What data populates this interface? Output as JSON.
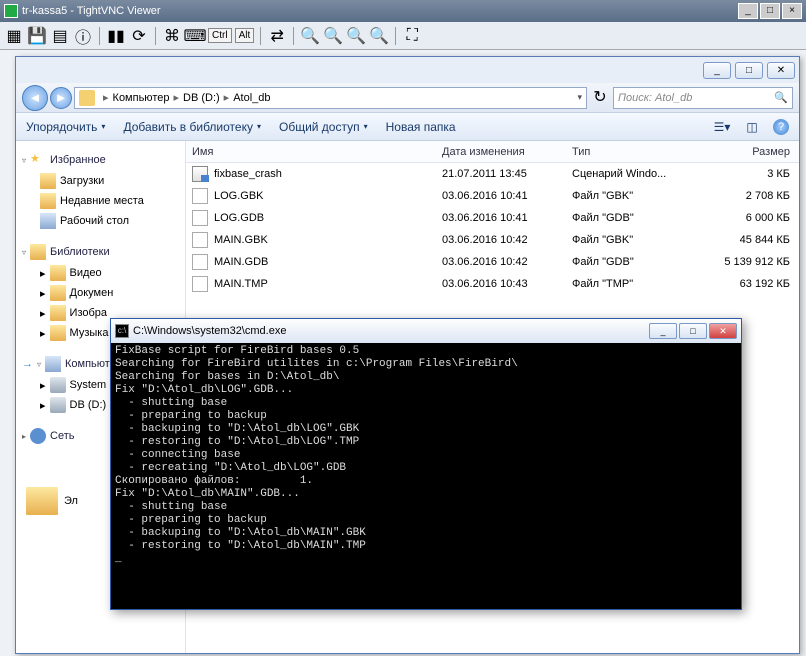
{
  "vnc": {
    "title": "tr-kassa5 - TightVNC Viewer",
    "ctrl": "Ctrl",
    "alt": "Alt"
  },
  "explorer": {
    "breadcrumb": [
      "Компьютер",
      "DB (D:)",
      "Atol_db"
    ],
    "search_placeholder": "Поиск: Atol_db",
    "menu": {
      "organize": "Упорядочить",
      "library": "Добавить в библиотеку",
      "share": "Общий доступ",
      "newfolder": "Новая папка"
    },
    "columns": {
      "name": "Имя",
      "date": "Дата изменения",
      "type": "Тип",
      "size": "Размер"
    },
    "sidebar": {
      "favorites": "Избранное",
      "fav_items": [
        "Загрузки",
        "Недавние места",
        "Рабочий стол"
      ],
      "libraries": "Библиотеки",
      "lib_items": [
        "Видео",
        "Докумен",
        "Изобра",
        "Музыка"
      ],
      "computer": "Компьют",
      "comp_items": [
        "System (",
        "DB (D:)"
      ],
      "network": "Сеть",
      "elements_prefix": "Эл"
    },
    "files": [
      {
        "name": "fixbase_crash",
        "date": "21.07.2011 13:45",
        "type": "Сценарий Windo...",
        "size": "3 КБ",
        "icon": "script"
      },
      {
        "name": "LOG.GBK",
        "date": "03.06.2016 10:41",
        "type": "Файл \"GBK\"",
        "size": "2 708 КБ",
        "icon": "file"
      },
      {
        "name": "LOG.GDB",
        "date": "03.06.2016 10:41",
        "type": "Файл \"GDB\"",
        "size": "6 000 КБ",
        "icon": "file"
      },
      {
        "name": "MAIN.GBK",
        "date": "03.06.2016 10:42",
        "type": "Файл \"GBK\"",
        "size": "45 844 КБ",
        "icon": "file",
        "mark": true
      },
      {
        "name": "MAIN.GDB",
        "date": "03.06.2016 10:42",
        "type": "Файл \"GDB\"",
        "size": "5 139 912 КБ",
        "icon": "file",
        "mark": true
      },
      {
        "name": "MAIN.TMP",
        "date": "03.06.2016 10:43",
        "type": "Файл \"TMP\"",
        "size": "63 192 КБ",
        "icon": "file"
      }
    ]
  },
  "cmd": {
    "title": "C:\\Windows\\system32\\cmd.exe",
    "body": "FixBase script for FireBird bases 0.5\nSearching for FireBird utilites in c:\\Program Files\\FireBird\\\nSearching for bases in D:\\Atol_db\\\nFix \"D:\\Atol_db\\LOG\".GDB...\n  - shutting base\n  - preparing to backup\n  - backuping to \"D:\\Atol_db\\LOG\".GBK\n  - restoring to \"D:\\Atol_db\\LOG\".TMP\n  - connecting base\n  - recreating \"D:\\Atol_db\\LOG\".GDB\nСкопировано файлов:         1.\nFix \"D:\\Atol_db\\MAIN\".GDB...\n  - shutting base\n  - preparing to backup\n  - backuping to \"D:\\Atol_db\\MAIN\".GBK\n  - restoring to \"D:\\Atol_db\\MAIN\".TMP\n_"
  }
}
